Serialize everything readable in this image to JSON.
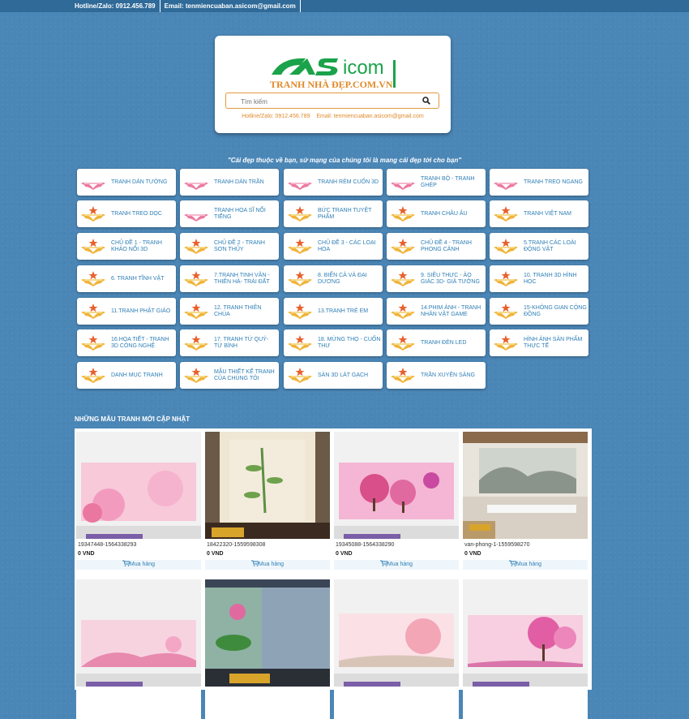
{
  "topbar": {
    "hotline": "Hotline/Zalo: 0912.456.789",
    "email": "Email: tenmiencuaban.asicom@gmail.com"
  },
  "header": {
    "logo_text": "ASicom",
    "logo_tagline": "TRANH NHÀ ĐẸP.COM.VN",
    "search_placeholder": "Tìm kiếm",
    "hotline": "Hotline/Zalo: 0912.456.789",
    "email": "Email: tenmiencuaban.asicom@gmail.com"
  },
  "slogan": "\"Cái đẹp thuộc về bạn, sứ mạng của chúng tôi là mang cái đẹp tới cho bạn\"",
  "categories": [
    {
      "label": "TRANH DÁN TƯỜNG",
      "icon": "wings-icon"
    },
    {
      "label": "TRANH DÁN TRẦN",
      "icon": "wings-icon"
    },
    {
      "label": "TRANH RÈM CUỐN 3D",
      "icon": "wings-icon"
    },
    {
      "label": "TRANH BỘ - TRANH GHÉP",
      "icon": "wings-icon"
    },
    {
      "label": "TRANH TREO NGANG",
      "icon": "wings-icon"
    },
    {
      "label": "TRANH TREO DỌC",
      "icon": "star-wings-icon"
    },
    {
      "label": "TRANH HỌA SĨ NỔI TIẾNG",
      "icon": "wings-icon"
    },
    {
      "label": "BỨC TRANH TUYỆT PHẨM",
      "icon": "star-wings-icon"
    },
    {
      "label": "TRANH CHÂU ÂU",
      "icon": "star-wings-icon"
    },
    {
      "label": "TRANH VIỆT NAM",
      "icon": "star-wings-icon"
    },
    {
      "label": "CHỦ ĐỀ 1 - TRANH KHẢO NỔI 3D",
      "icon": "star-wings-icon"
    },
    {
      "label": "CHỦ ĐỀ 2 - TRANH SƠN THỦY",
      "icon": "star-wings-icon"
    },
    {
      "label": "CHỦ ĐỀ 3 - CÁC LOẠI HOA",
      "icon": "star-wings-icon"
    },
    {
      "label": "CHỦ ĐỀ 4 - TRANH PHONG CẢNH",
      "icon": "star-wings-icon"
    },
    {
      "label": "5.TRANH CÁC LOÀI ĐỘNG VẬT",
      "icon": "star-wings-icon"
    },
    {
      "label": "6. TRANH TĨNH VẬT",
      "icon": "star-wings-icon"
    },
    {
      "label": "7.TRANH TINH VÂN - THIÊN HÀ- TRÁI ĐẤT",
      "icon": "star-wings-icon"
    },
    {
      "label": "8. BIỂN CẢ VÀ ĐẠI DƯƠNG",
      "icon": "star-wings-icon"
    },
    {
      "label": "9. SIÊU THỰC - ẢO GIÁC 3D- GIẢ TƯỞNG",
      "icon": "star-wings-icon"
    },
    {
      "label": "10. TRANH 3D HÌNH HỌC",
      "icon": "star-wings-icon"
    },
    {
      "label": "11.TRANH PHẬT GIÁO",
      "icon": "star-wings-icon"
    },
    {
      "label": "12. TRANH THIÊN CHÚA",
      "icon": "star-wings-icon"
    },
    {
      "label": "13.TRANH TRẺ EM",
      "icon": "star-wings-icon"
    },
    {
      "label": "14.PHIM ẢNH - TRANH NHÂN VẬT GAME",
      "icon": "star-wings-icon"
    },
    {
      "label": "15-KHÔNG GIAN CỘNG ĐỒNG",
      "icon": "star-wings-icon"
    },
    {
      "label": "16.HỌA TIẾT - TRANH 3D CÔNG NGHỆ",
      "icon": "star-wings-icon"
    },
    {
      "label": "17. TRANH TỨ QUÝ- TỨ BÌNH",
      "icon": "star-wings-icon"
    },
    {
      "label": "18. MỪNG THỌ - CUỐN THƯ",
      "icon": "star-wings-icon"
    },
    {
      "label": "TRANH ĐÈN LED",
      "icon": "star-wings-icon"
    },
    {
      "label": "HÌNH ẢNH SẢN PHẨM THỰC TẾ",
      "icon": "star-wings-icon"
    },
    {
      "label": "DANH MỤC TRANH",
      "icon": "star-wings-icon"
    },
    {
      "label": "MẪU THIẾT KẾ TRANH CỦA CHÚNG TÔI",
      "icon": "star-wings-icon"
    },
    {
      "label": "SÀN 3D LÁT GẠCH",
      "icon": "star-wings-icon"
    },
    {
      "label": "TRẦN XUYÊN SÁNG",
      "icon": "star-wings-icon"
    }
  ],
  "section_title": "NHỮNG MẪU TRANH MỚI CẬP NHẬT",
  "products": [
    {
      "name": "19347448-1564338293",
      "price": "0 VND",
      "buy_label": "Mua hàng",
      "image": "pink-sakura-banner"
    },
    {
      "name": "18422320-1559598308",
      "price": "0 VND",
      "buy_label": "Mua hàng",
      "image": "bamboo-curtain-room"
    },
    {
      "name": "19345088-1564338290",
      "price": "0 VND",
      "buy_label": "Mua hàng",
      "image": "pink-trees-banner"
    },
    {
      "name": "van-phong-1-1559598270",
      "price": "0 VND",
      "buy_label": "Mua hàng",
      "image": "office-mural"
    },
    {
      "name": "",
      "price": "",
      "buy_label": "",
      "image": "pink-sakura-banner-2"
    },
    {
      "name": "",
      "price": "",
      "buy_label": "",
      "image": "lotus-window-room"
    },
    {
      "name": "",
      "price": "",
      "buy_label": "",
      "image": "sakura-landscape-banner"
    },
    {
      "name": "",
      "price": "",
      "buy_label": "",
      "image": "pink-tree-banner"
    }
  ],
  "colors": {
    "background": "#4a86b6",
    "topbar": "#2f6a98",
    "link": "#2f7fb5",
    "accent_orange": "#e08a2a",
    "logo_green": "#1aa34a"
  }
}
